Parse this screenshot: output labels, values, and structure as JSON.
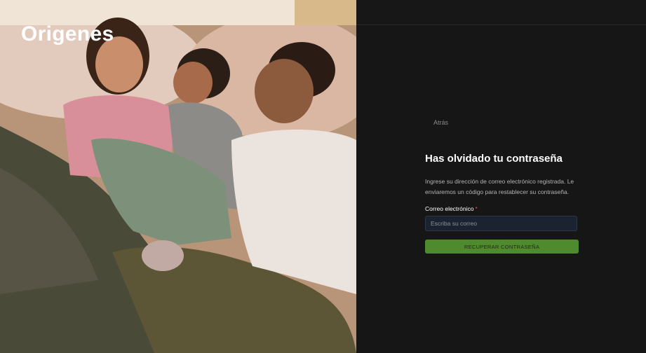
{
  "brand": {
    "logo_text": "Origenes"
  },
  "photo": {
    "subject": "family-in-bed-photo"
  },
  "form": {
    "back_label": "Atrás",
    "title": "Has olvidado tu contraseña",
    "description": "Ingrese su dirección de correo electrónico registrada. Le enviaremos un código para restablecer su contraseña.",
    "email_label": "Correo electrónico",
    "required_marker": "*",
    "email_value": "",
    "email_placeholder": "Escriba su correo",
    "submit_label": "RECUPERAR CONTRASEÑA"
  },
  "colors": {
    "background": "#161616",
    "accent_button": "#4f8a2f",
    "input_bg": "#1c2330",
    "required": "#e05a5a"
  }
}
